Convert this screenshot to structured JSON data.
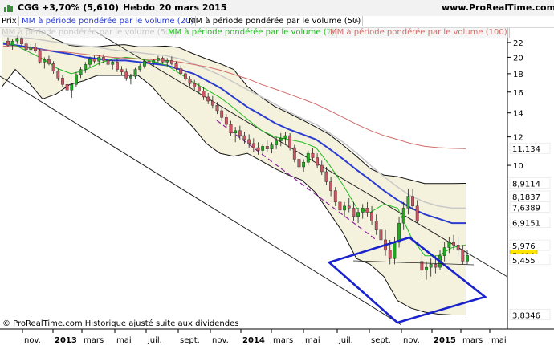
{
  "header": {
    "ticker": "CGG",
    "change": "+3,70% (5,610)",
    "period": "Hebdo",
    "date": "20 mars 2015",
    "site": "www.ProRealTime.com"
  },
  "legend_top": [
    {
      "label": "Prix",
      "color": "#000000"
    },
    {
      "label": "MM à période pondérée par le volume (20)",
      "color": "#2a3bd0"
    },
    {
      "label": "MM à période pondérée par le volume (50)",
      "color": "#000000"
    }
  ],
  "legend_second": [
    {
      "label": "MM à période pondérée par le volume (50)",
      "color": "#c8c8c8"
    },
    {
      "label": "MM à période pondérée par le volume (7)",
      "color": "#22bb22"
    },
    {
      "label": "MM à période pondérée par le volume (100)",
      "color": "#d26a6a"
    }
  ],
  "footer": "© ProRealTime.com Historique ajusté suite aux dividendes",
  "colors": {
    "candle_up": "#22aa22",
    "candle_down": "#cc5566",
    "ma20": "#2a3bd0",
    "ma7": "#22bb22",
    "ma50": "#c8c8c8",
    "ma100": "#d26a6a",
    "channel": "#1a22cc",
    "band_fill": "#f4f2dc"
  },
  "chart_data": {
    "type": "candlestick",
    "scale": "log",
    "ylim": [
      3.5,
      24
    ],
    "x_ticks": [
      "nov.",
      "2013",
      "mars",
      "mai",
      "juil.",
      "sept.",
      "nov.",
      "2014",
      "mars",
      "mai",
      "juil.",
      "sept.",
      "nov.",
      "2015",
      "mars",
      "mai"
    ],
    "y_ticks": [
      22,
      20,
      18,
      16,
      14,
      12,
      10
    ],
    "price_labels": [
      {
        "value": 11.134,
        "label": "11,134",
        "color": "#c00000"
      },
      {
        "value": 8.9114,
        "label": "8,9114",
        "color": "#000000"
      },
      {
        "value": 8.1837,
        "label": "8,1837",
        "color": "#000000"
      },
      {
        "value": 7.6389,
        "label": "7,6389",
        "color": "#bbbbbb"
      },
      {
        "value": 6.9151,
        "label": "6,9151",
        "color": "#2a3bd0"
      },
      {
        "value": 5.976,
        "label": "5,976",
        "color": "#22bb22"
      },
      {
        "value": 5.61,
        "label": "5,610",
        "color": "#000000",
        "highlight": "#ffe600"
      },
      {
        "value": 5.455,
        "label": "5,455",
        "color": "#000000"
      },
      {
        "value": 3.8346,
        "label": "3,8346",
        "color": "#000000"
      }
    ],
    "series": [
      {
        "name": "MM à période pondérée par le volume (20)",
        "values": [
          21.8,
          21.6,
          21.3,
          21.0,
          20.7,
          20.4,
          20.0,
          19.8,
          19.6,
          19.6,
          19.4,
          19.2,
          19.0,
          18.5,
          18.0,
          17.2,
          16.4,
          15.4,
          14.5,
          13.8,
          13.1,
          12.6,
          12.2,
          11.8,
          11.1,
          10.4,
          9.7,
          9.1,
          8.5,
          8.0,
          7.6,
          7.3,
          7.1,
          6.9,
          6.9
        ]
      },
      {
        "name": "MM à période pondérée par le volume (7)",
        "values": [
          22.0,
          21.5,
          20.6,
          19.7,
          18.6,
          18.0,
          18.4,
          19.2,
          19.8,
          20.0,
          19.8,
          19.5,
          19.0,
          18.0,
          17.0,
          16.2,
          15.4,
          14.4,
          13.4,
          12.5,
          12.0,
          11.8,
          11.6,
          11.2,
          10.0,
          8.8,
          7.6,
          7.4,
          7.8,
          7.6,
          6.3,
          5.6,
          5.6,
          5.9,
          6.0
        ]
      },
      {
        "name": "MM à période pondérée par le volume (50)",
        "values": [
          23.0,
          22.8,
          22.6,
          22.3,
          22.0,
          21.7,
          21.5,
          21.3,
          21.0,
          20.8,
          20.6,
          20.4,
          20.2,
          19.8,
          19.2,
          18.5,
          17.8,
          17.0,
          16.2,
          15.5,
          14.8,
          14.1,
          13.5,
          13.0,
          12.3,
          11.6,
          10.8,
          10.0,
          9.3,
          8.7,
          8.2,
          7.9,
          7.7,
          7.6,
          7.6
        ]
      },
      {
        "name": "MM à période pondérée par le volume (100)",
        "values": [
          21.5,
          21.4,
          21.2,
          21.0,
          20.8,
          20.6,
          20.4,
          20.2,
          20.0,
          19.9,
          19.8,
          19.7,
          19.6,
          19.4,
          19.1,
          18.8,
          18.4,
          17.9,
          17.4,
          16.8,
          16.3,
          15.8,
          15.3,
          14.8,
          14.2,
          13.6,
          13.0,
          12.5,
          12.1,
          11.8,
          11.5,
          11.3,
          11.2,
          11.15,
          11.13
        ]
      }
    ],
    "band_upper": [
      24.5,
      24.5,
      24.0,
      23.5,
      22.4,
      21.6,
      21.4,
      21.4,
      21.6,
      21.7,
      21.4,
      21.4,
      21.5,
      21.3,
      20.5,
      19.8,
      19.2,
      18.5,
      16.6,
      15.5,
      14.6,
      14.0,
      13.4,
      12.8,
      12.2,
      11.4,
      10.6,
      9.8,
      9.4,
      9.3,
      9.1,
      8.9,
      8.9,
      8.9,
      8.91
    ],
    "band_lower": [
      16.5,
      18.5,
      17.0,
      15.3,
      15.8,
      16.8,
      17.2,
      17.8,
      17.8,
      17.8,
      17.8,
      16.6,
      15.0,
      14.0,
      12.8,
      11.5,
      10.8,
      10.6,
      10.8,
      10.3,
      9.8,
      9.4,
      9.1,
      8.4,
      7.4,
      6.5,
      5.5,
      5.3,
      4.9,
      4.2,
      4.0,
      3.9,
      3.85,
      3.83,
      3.83
    ],
    "candles_ohlc": [
      [
        22.2,
        22.8,
        21.4,
        21.6
      ],
      [
        21.6,
        22.5,
        21.0,
        22.2
      ],
      [
        22.2,
        23.0,
        21.8,
        22.6
      ],
      [
        22.6,
        22.9,
        21.5,
        21.8
      ],
      [
        21.8,
        22.3,
        20.8,
        21.0
      ],
      [
        21.0,
        21.8,
        20.2,
        21.4
      ],
      [
        21.4,
        21.9,
        20.6,
        20.9
      ],
      [
        20.9,
        21.1,
        19.2,
        19.4
      ],
      [
        19.4,
        20.0,
        18.6,
        19.7
      ],
      [
        19.7,
        20.2,
        19.0,
        19.2
      ],
      [
        19.2,
        19.5,
        18.0,
        18.3
      ],
      [
        18.3,
        18.6,
        17.2,
        17.5
      ],
      [
        17.5,
        17.8,
        16.5,
        16.8
      ],
      [
        16.8,
        17.2,
        15.8,
        16.2
      ],
      [
        16.2,
        17.0,
        15.4,
        16.8
      ],
      [
        16.8,
        18.2,
        16.5,
        17.9
      ],
      [
        17.9,
        18.8,
        17.5,
        18.5
      ],
      [
        18.5,
        19.4,
        18.1,
        19.1
      ],
      [
        19.1,
        20.1,
        18.8,
        19.8
      ],
      [
        19.8,
        20.2,
        19.2,
        19.5
      ],
      [
        19.5,
        20.3,
        19.0,
        20.0
      ],
      [
        20.0,
        20.4,
        19.3,
        19.6
      ],
      [
        19.6,
        19.9,
        18.8,
        19.1
      ],
      [
        19.1,
        19.6,
        18.5,
        19.4
      ],
      [
        19.4,
        19.8,
        18.2,
        18.5
      ],
      [
        18.5,
        18.9,
        17.8,
        18.2
      ],
      [
        18.2,
        18.6,
        17.2,
        17.5
      ],
      [
        17.5,
        18.0,
        16.8,
        17.7
      ],
      [
        17.7,
        18.7,
        17.4,
        18.5
      ],
      [
        18.5,
        19.2,
        18.2,
        18.9
      ],
      [
        18.9,
        19.8,
        18.6,
        19.5
      ],
      [
        19.5,
        20.1,
        19.0,
        19.3
      ],
      [
        19.3,
        19.8,
        18.9,
        19.6
      ],
      [
        19.6,
        20.2,
        19.2,
        19.9
      ],
      [
        19.9,
        20.1,
        19.2,
        19.4
      ],
      [
        19.4,
        19.9,
        18.9,
        19.6
      ],
      [
        19.6,
        20.1,
        19.0,
        19.2
      ],
      [
        19.2,
        19.5,
        18.4,
        18.6
      ],
      [
        18.6,
        19.0,
        17.8,
        18.0
      ],
      [
        18.0,
        18.3,
        17.2,
        17.4
      ],
      [
        17.4,
        17.7,
        16.6,
        16.9
      ],
      [
        16.9,
        17.3,
        16.2,
        16.5
      ],
      [
        16.5,
        16.9,
        15.8,
        16.1
      ],
      [
        16.1,
        16.5,
        15.2,
        15.5
      ],
      [
        15.5,
        15.9,
        14.8,
        15.1
      ],
      [
        15.1,
        15.6,
        14.4,
        14.7
      ],
      [
        14.7,
        15.0,
        13.9,
        14.2
      ],
      [
        14.2,
        14.5,
        13.3,
        13.6
      ],
      [
        13.6,
        13.9,
        12.8,
        13.0
      ],
      [
        13.0,
        13.3,
        12.1,
        12.3
      ],
      [
        12.3,
        12.8,
        11.6,
        12.5
      ],
      [
        12.5,
        12.9,
        11.8,
        12.1
      ],
      [
        12.1,
        12.4,
        11.5,
        11.8
      ],
      [
        11.8,
        12.2,
        11.2,
        11.5
      ],
      [
        11.5,
        11.9,
        10.9,
        11.2
      ],
      [
        11.2,
        11.6,
        10.7,
        11.0
      ],
      [
        11.0,
        11.5,
        10.6,
        11.3
      ],
      [
        11.3,
        11.8,
        10.9,
        11.1
      ],
      [
        11.1,
        11.6,
        10.8,
        11.4
      ],
      [
        11.4,
        12.0,
        11.1,
        11.7
      ],
      [
        11.7,
        12.3,
        11.3,
        11.9
      ],
      [
        11.9,
        12.4,
        11.5,
        12.1
      ],
      [
        12.1,
        12.3,
        11.0,
        11.2
      ],
      [
        11.2,
        11.4,
        10.2,
        10.4
      ],
      [
        10.4,
        10.7,
        9.7,
        9.9
      ],
      [
        9.9,
        10.4,
        9.6,
        10.2
      ],
      [
        10.2,
        11.0,
        10.0,
        10.8
      ],
      [
        10.8,
        11.2,
        10.3,
        10.5
      ],
      [
        10.5,
        10.8,
        9.8,
        10.0
      ],
      [
        10.0,
        10.3,
        9.4,
        9.6
      ],
      [
        9.6,
        9.9,
        8.8,
        9.0
      ],
      [
        9.0,
        9.3,
        8.2,
        8.5
      ],
      [
        8.5,
        8.7,
        7.7,
        7.9
      ],
      [
        7.9,
        8.2,
        7.3,
        7.5
      ],
      [
        7.5,
        7.9,
        7.2,
        7.7
      ],
      [
        7.7,
        8.1,
        7.4,
        7.6
      ],
      [
        7.6,
        7.9,
        7.0,
        7.2
      ],
      [
        7.2,
        7.6,
        6.9,
        7.4
      ],
      [
        7.4,
        7.8,
        7.1,
        7.6
      ],
      [
        7.6,
        7.9,
        7.2,
        7.4
      ],
      [
        7.4,
        7.7,
        6.8,
        7.0
      ],
      [
        7.0,
        7.3,
        6.4,
        6.6
      ],
      [
        6.6,
        6.9,
        6.0,
        6.2
      ],
      [
        6.2,
        6.6,
        5.6,
        5.8
      ],
      [
        5.8,
        6.2,
        5.3,
        5.5
      ],
      [
        5.5,
        6.3,
        5.3,
        6.1
      ],
      [
        6.1,
        7.2,
        5.9,
        6.9
      ],
      [
        6.9,
        7.9,
        6.6,
        7.6
      ],
      [
        7.6,
        8.6,
        7.3,
        8.2
      ],
      [
        8.2,
        8.6,
        7.5,
        7.7
      ],
      [
        7.7,
        8.0,
        6.9,
        7.0
      ],
      [
        5.4,
        5.8,
        4.9,
        5.1
      ],
      [
        5.1,
        5.4,
        4.8,
        5.2
      ],
      [
        5.2,
        5.5,
        4.9,
        5.3
      ],
      [
        5.3,
        5.6,
        5.0,
        5.2
      ],
      [
        5.2,
        5.8,
        5.1,
        5.6
      ],
      [
        5.6,
        6.1,
        5.4,
        5.9
      ],
      [
        5.9,
        6.3,
        5.7,
        6.1
      ],
      [
        6.1,
        6.4,
        5.8,
        6.0
      ],
      [
        6.0,
        6.3,
        5.6,
        5.8
      ],
      [
        5.8,
        6.0,
        5.3,
        5.41
      ],
      [
        5.41,
        5.8,
        5.3,
        5.61
      ]
    ]
  }
}
